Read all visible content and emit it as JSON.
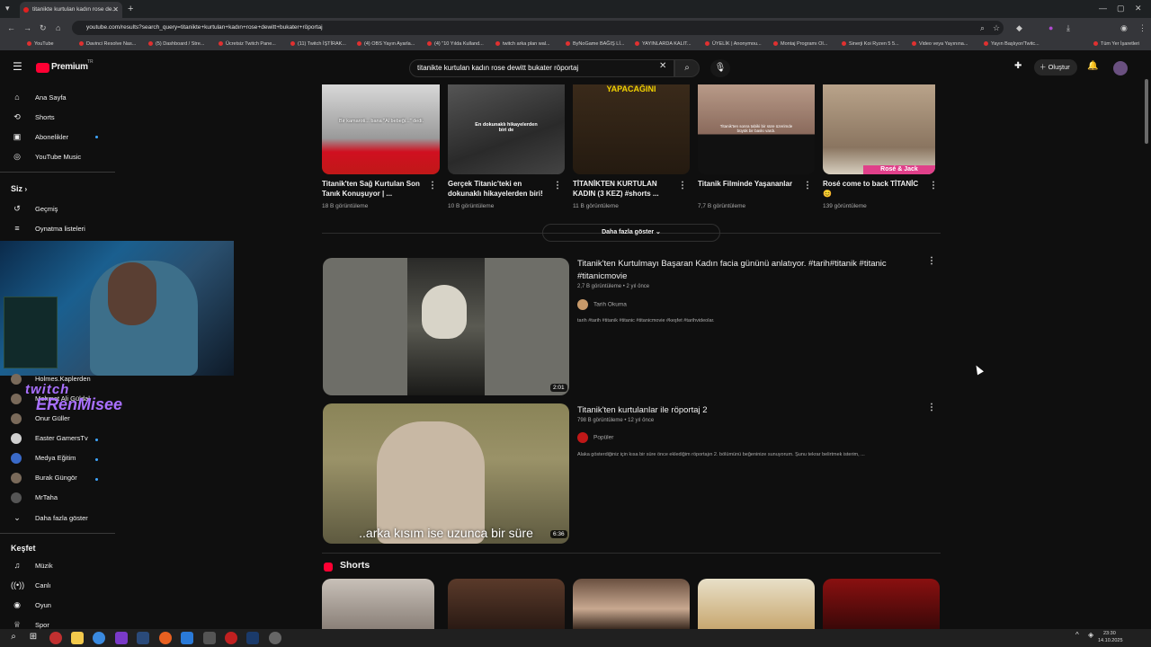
{
  "browser": {
    "tab_title": "titanikte kurtulan kadın rose de...",
    "url": "youtube.com/results?search_query=titanikte+kurtulan+kadın+rose+dewitt+bukater+röportaj",
    "bookmarks": [
      "YouTube",
      "Davinci Resolve Nas...",
      "(5) Dashboard / Stre...",
      "Ücretsiz Twitch Pane...",
      "(11) Twitch İŞTİRAK...",
      "(4) OBS Yayın Ayarla...",
      "(4) \"10 Yılda Kulland...",
      "twitch arka plan wal...",
      "ByNoGame BAĞIŞ Lİ...",
      "YAYINLARDA KALIT...",
      "ÜYELİK | Anonymou...",
      "Montaj Programı Ol...",
      "Sinerji Koi Ryzen 5 5...",
      "Video veya Yayınına...",
      "Yayın Başlıyor/Twitc..."
    ],
    "bookmarks_all": "Tüm Yer İşaretleri"
  },
  "youtube": {
    "logo": "Premium",
    "logo_sup": "TR",
    "search_query": "titanikte kurtulan kadın rose dewitt bukater röportaj",
    "create_label": "Oluştur"
  },
  "sidebar": {
    "main": [
      {
        "label": "Ana Sayfa",
        "icon": "home-icon"
      },
      {
        "label": "Shorts",
        "icon": "shorts-icon"
      },
      {
        "label": "Abonelikler",
        "icon": "subscriptions-icon"
      },
      {
        "label": "YouTube Music",
        "icon": "music-icon"
      }
    ],
    "you_header": "Siz",
    "you": [
      {
        "label": "Geçmiş"
      },
      {
        "label": "Oynatma listeleri"
      }
    ],
    "subs": [
      {
        "label": "Holmes.Kaplerden"
      },
      {
        "label": "Mehmet Ali Güldal"
      },
      {
        "label": "Onur Güller"
      },
      {
        "label": "Easter GamersTv"
      },
      {
        "label": "Medya Eğitim"
      },
      {
        "label": "Burak Güngör"
      },
      {
        "label": "MrTaha"
      }
    ],
    "show_more": "Daha fazla göster",
    "explore_header": "Keşfet",
    "explore": [
      {
        "label": "Müzik"
      },
      {
        "label": "Canlı"
      },
      {
        "label": "Oyun"
      },
      {
        "label": "Spor"
      }
    ]
  },
  "overlay": {
    "twitch": "twitch",
    "channel": "ERenMisee"
  },
  "top_row": [
    {
      "title": "Titanik'ten Sağ Kurtulan Son Tanık Konuşuyor | ...",
      "views": "18 B görüntüleme",
      "caption": "Bir kamaroti... bana \"Al bebeği...\" dedi."
    },
    {
      "title": "Gerçek Titanic'teki en dokunaklı hikayelerden biri!",
      "views": "10 B görüntüleme",
      "caption": "En dokunaklı hikayelerden biri de"
    },
    {
      "title": "TİTANİKTEN KURTULAN KADIN (3 KEZ) #shorts ...",
      "views": "11 B görüntüleme",
      "caption": "YAPACAĞINI"
    },
    {
      "title": "Titanik Filminde Yaşananlar",
      "views": "7,7 B görüntüleme",
      "caption": "Titanik'ten sonra tabiki bir süre üzerimde büyük bir baskı vardı."
    },
    {
      "title": "Rosé come to back TİTANİC😊",
      "views": "139 görüntüleme",
      "caption": "Rosé & Jack"
    }
  ],
  "more_label": "Daha fazla göster",
  "results": [
    {
      "title": "Titanik'ten Kurtulmayı Başaran Kadın facia gününü anlatıyor. #tarih#titanik #titanic #titanicmovie",
      "meta": "2,7 B görüntüleme • 2 yıl önce",
      "channel": "Tarih Okuma",
      "desc": "tarih #tarih #titanik #titanic #titanicmovie #keşfet #tarihvideolar.",
      "duration": "2:01"
    },
    {
      "title": "Titanik'ten kurtulanlar ile röportaj 2",
      "meta": "798 B görüntüleme • 12 yıl önce",
      "channel": "Popüler",
      "desc": "Alaka gösterdiğiniz için kısa bir süre önce eklediğim röportajın 2. bölümünü beğeninize sunuyorum. Şunu tekrar belirtmek isterim, ...",
      "duration": "6:36",
      "subtitle": "..arka kısım ise uzunca bir süre"
    }
  ],
  "shorts_header": "Shorts",
  "taskbar": {
    "time": "23:30",
    "date": "14.10.2025"
  }
}
